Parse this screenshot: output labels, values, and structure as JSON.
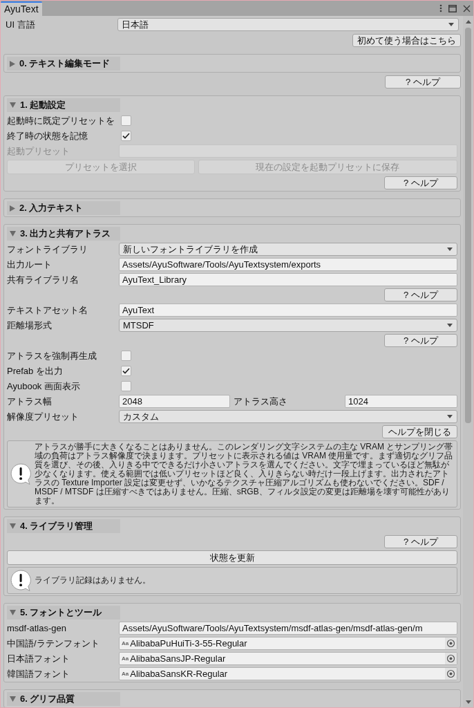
{
  "window": {
    "tab": "AyuText"
  },
  "ui_language": {
    "label": "UI 言語",
    "value": "日本語"
  },
  "first_use_button": "初めて使う場合はこちら",
  "blocks": [
    {
      "kind": "section",
      "title": "0. テキスト編集モード",
      "expanded": false
    },
    {
      "kind": "help_button",
      "label": "? ヘルプ"
    },
    {
      "kind": "section",
      "title": "1. 起動設定",
      "expanded": true,
      "rows": [
        {
          "kind": "checkbox",
          "label": "起動時に既定プリセットを",
          "checked": false
        },
        {
          "kind": "checkbox",
          "label": "終了時の状態を記憶",
          "checked": true
        },
        {
          "kind": "text",
          "label": "起動プリセット",
          "disabled": true
        },
        {
          "kind": "buttons",
          "buttons": [
            {
              "label": "プリセットを選択",
              "disabled": true
            },
            {
              "label": "現在の設定を起動プリセットに保存",
              "disabled": true
            }
          ]
        },
        {
          "kind": "help_button",
          "label": "? ヘルプ"
        }
      ]
    },
    {
      "kind": "section",
      "title": "2. 入力テキスト",
      "expanded": false
    },
    {
      "kind": "section",
      "title": "3. 出力と共有アトラス",
      "expanded": true,
      "rows": [
        {
          "kind": "dropdown",
          "label": "フォントライブラリ",
          "value": "新しいフォントライブラリを作成"
        },
        {
          "kind": "text",
          "label": "出力ルート",
          "value": "Assets/AyuSoftware/Tools/AyuTextsystem/exports",
          "disabled": false
        },
        {
          "kind": "text",
          "label": "共有ライブラリ名",
          "value": "AyuText_Library",
          "disabled": false
        },
        {
          "kind": "help_button",
          "label": "? ヘルプ"
        },
        {
          "kind": "text",
          "label": "テキストアセット名",
          "value": "AyuText",
          "disabled": false
        },
        {
          "kind": "dropdown",
          "label": "距離場形式",
          "value": "MTSDF"
        },
        {
          "kind": "help_button",
          "label": "? ヘルプ"
        },
        {
          "kind": "checkbox",
          "label": "アトラスを強制再生成",
          "checked": false
        },
        {
          "kind": "checkbox",
          "label": "Prefab を出力",
          "checked": true
        },
        {
          "kind": "checkbox",
          "label": "Ayubook 画面表示",
          "checked": false
        },
        {
          "kind": "text_pair",
          "fields": [
            {
              "label": "アトラス幅",
              "value": "2048"
            },
            {
              "label": "アトラス高さ",
              "value": "1024"
            }
          ]
        },
        {
          "kind": "dropdown",
          "label": "解像度プリセット",
          "value": "カスタム"
        },
        {
          "kind": "help_button",
          "label": "ヘルプを閉じる"
        },
        {
          "kind": "message",
          "text": "アトラスが勝手に大きくなることはありません。このレンダリング文字システムの主な VRAM とサンプリング帯域の負荷はアトラス解像度で決まります。プリセットに表示される値は VRAM 使用量です。まず適切なグリフ品質を選び、その後、入りきる中でできるだけ小さいアトラスを選んでください。文字で埋まっているほど無駄が少なくなります。使える範囲では低いプリセットほど良く、入りきらない時だけ一段上げます。出力されたアトラスの Texture Importer 設定は変更せず、いかなるテクスチャ圧縮アルゴリズムも使わないでください。SDF / MSDF / MTSDF は圧縮すべきではありません。圧縮、sRGB、フィルタ設定の変更は距離場を壊す可能性があります。"
        }
      ]
    },
    {
      "kind": "section",
      "title": "4. ライブラリ管理",
      "expanded": true,
      "rows": [
        {
          "kind": "help_button",
          "label": "? ヘルプ"
        },
        {
          "kind": "wide_button",
          "label": "状態を更新"
        },
        {
          "kind": "message",
          "text": "ライブラリ記録はありません。"
        }
      ]
    },
    {
      "kind": "section",
      "title": "5. フォントとツール",
      "expanded": true,
      "rows": [
        {
          "kind": "text",
          "label": "msdf-atlas-gen",
          "value": "Assets/AyuSoftware/Tools/AyuTextsystem/msdf-atlas-gen/msdf-atlas-gen/m",
          "disabled": false
        },
        {
          "kind": "object",
          "label": "中国語/ラテンフォント",
          "icon": "Aa",
          "value": "AlibabaPuHuiTi-3-55-Regular"
        },
        {
          "kind": "object",
          "label": "日本語フォント",
          "icon": "Aa",
          "value": "AlibabaSansJP-Regular"
        },
        {
          "kind": "object",
          "label": "韓国語フォント",
          "icon": "Aa",
          "value": "AlibabaSansKR-Regular"
        }
      ]
    },
    {
      "kind": "section",
      "title": "6. グリフ品質",
      "expanded": true
    }
  ]
}
